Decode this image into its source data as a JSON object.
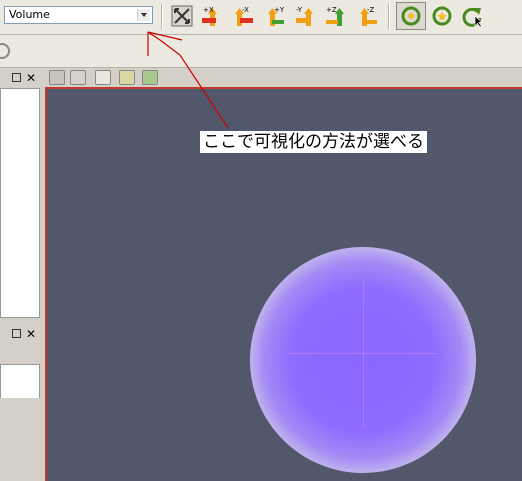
{
  "toolbar": {
    "representation_value": "Volume",
    "view_buttons": [
      {
        "label": "+X"
      },
      {
        "label": "-X"
      },
      {
        "label": "+Y"
      },
      {
        "label": "-Y"
      },
      {
        "label": "+Z"
      },
      {
        "label": "-Z"
      }
    ]
  },
  "annotation": {
    "text": "ここで可視化の方法が選べる"
  },
  "colors": {
    "viewport_bg": "#52576c",
    "active_border": "#c0392b",
    "annotation_arrow": "#cc0000",
    "volume_core": "#8a67ff"
  }
}
